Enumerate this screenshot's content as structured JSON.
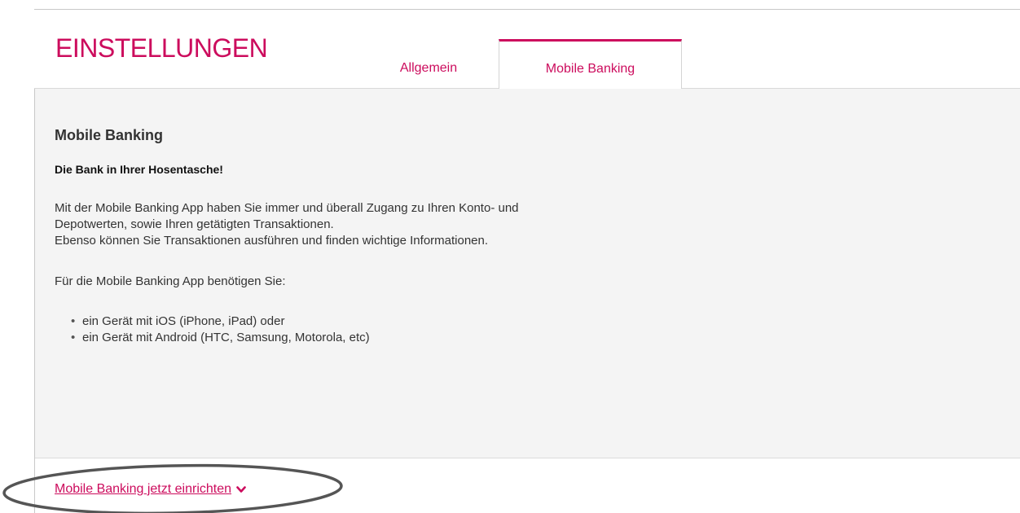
{
  "header": {
    "title": "EINSTELLUNGEN",
    "tabs": [
      {
        "label": "Allgemein",
        "active": false
      },
      {
        "label": "Mobile Banking",
        "active": true
      }
    ]
  },
  "main": {
    "section_title": "Mobile Banking",
    "tagline": "Die Bank in Ihrer Hosentasche!",
    "paragraph_lines": [
      "Mit der Mobile Banking App haben Sie immer und überall Zugang zu Ihren Konto- und",
      "Depotwerten, sowie Ihren getätigten Transaktionen.",
      "Ebenso können Sie Transaktionen ausführen und finden wichtige Informationen."
    ],
    "requirements_intro": "Für die Mobile Banking App benötigen Sie:",
    "requirements": [
      "ein Gerät mit iOS (iPhone, iPad) oder",
      "ein Gerät mit Android (HTC, Samsung, Motorola, etc)"
    ]
  },
  "footer": {
    "setup_link": "Mobile Banking jetzt einrichten",
    "setup_icon": "chevron-down-icon"
  },
  "colors": {
    "brand": "#cc0c5d",
    "content_background": "#f4f4f4",
    "annotation": "#555555"
  }
}
